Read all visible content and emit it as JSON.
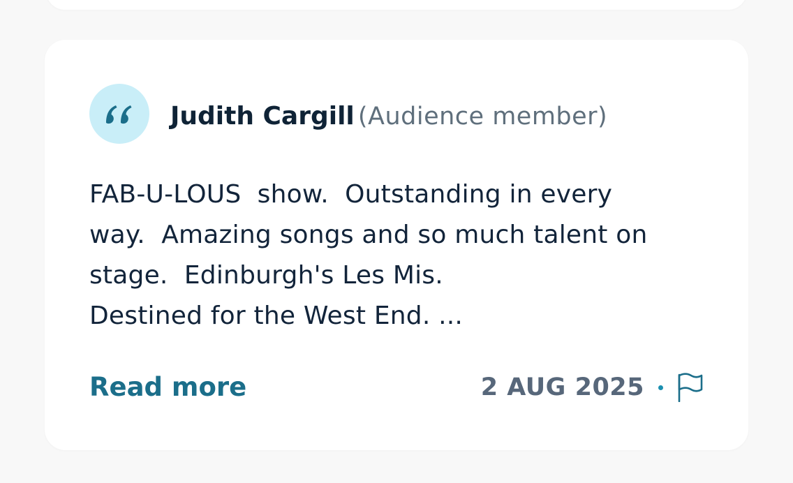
{
  "review": {
    "author_name": "Judith Cargill",
    "author_role": "(Audience member)",
    "body": "FAB-U-LOUS  show.  Outstanding in every\nway.  Amazing songs and so much talent on\nstage.  Edinburgh's Les Mis.\nDestined for the West End. ...",
    "read_more_label": "Read more",
    "date": "2 AUG 2025"
  },
  "icons": {
    "quote": "quote-icon",
    "flag": "flag-icon"
  },
  "colors": {
    "accent": "#1b6e8a",
    "badge_bg": "#c9eef8",
    "text_dark": "#0f2336",
    "text_muted": "#57677a"
  }
}
